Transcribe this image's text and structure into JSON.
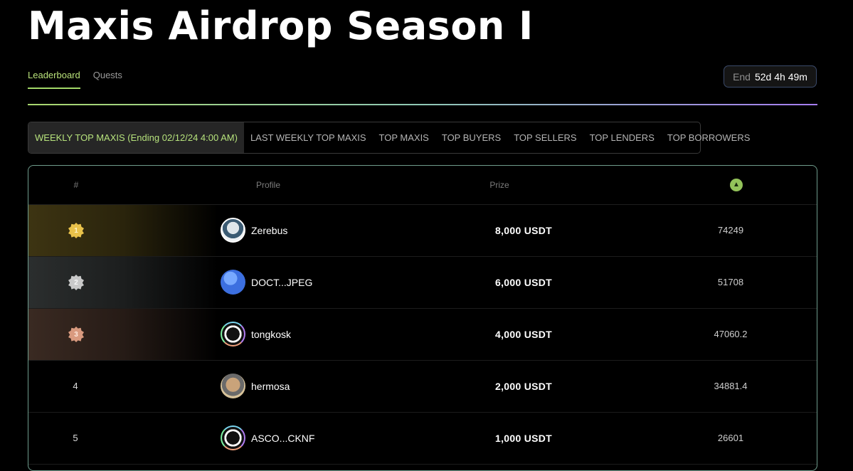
{
  "page": {
    "title": "Maxis Airdrop Season I"
  },
  "tabs": [
    {
      "label": "Leaderboard",
      "active": true
    },
    {
      "label": "Quests",
      "active": false
    }
  ],
  "timer": {
    "label": "End",
    "value": "52d 4h 49m"
  },
  "subtabs": [
    {
      "label": "WEEKLY TOP MAXIS (Ending 02/12/24 4:00 AM)",
      "active": true
    },
    {
      "label": "LAST WEEKLY TOP MAXIS"
    },
    {
      "label": "TOP MAXIS"
    },
    {
      "label": "TOP BUYERS"
    },
    {
      "label": "TOP SELLERS"
    },
    {
      "label": "TOP LENDERS"
    },
    {
      "label": "TOP BORROWERS"
    }
  ],
  "table": {
    "headers": {
      "rank": "#",
      "profile": "Profile",
      "prize": "Prize",
      "score_icon": "leaf-token-icon"
    },
    "rows": [
      {
        "rank": "1",
        "name": "Zerebus",
        "prize": "8,000 USDT",
        "score": "74249"
      },
      {
        "rank": "2",
        "name": "DOCT...JPEG",
        "prize": "6,000 USDT",
        "score": "51708"
      },
      {
        "rank": "3",
        "name": "tongkosk",
        "prize": "4,000 USDT",
        "score": "47060.2"
      },
      {
        "rank": "4",
        "name": "hermosa",
        "prize": "2,000 USDT",
        "score": "34881.4"
      },
      {
        "rank": "5",
        "name": "ASCO...CKNF",
        "prize": "1,000 USDT",
        "score": "26601"
      }
    ]
  },
  "colors": {
    "accent": "#a3d968",
    "border": "#6f9c8c",
    "purple": "#a47cf0"
  }
}
